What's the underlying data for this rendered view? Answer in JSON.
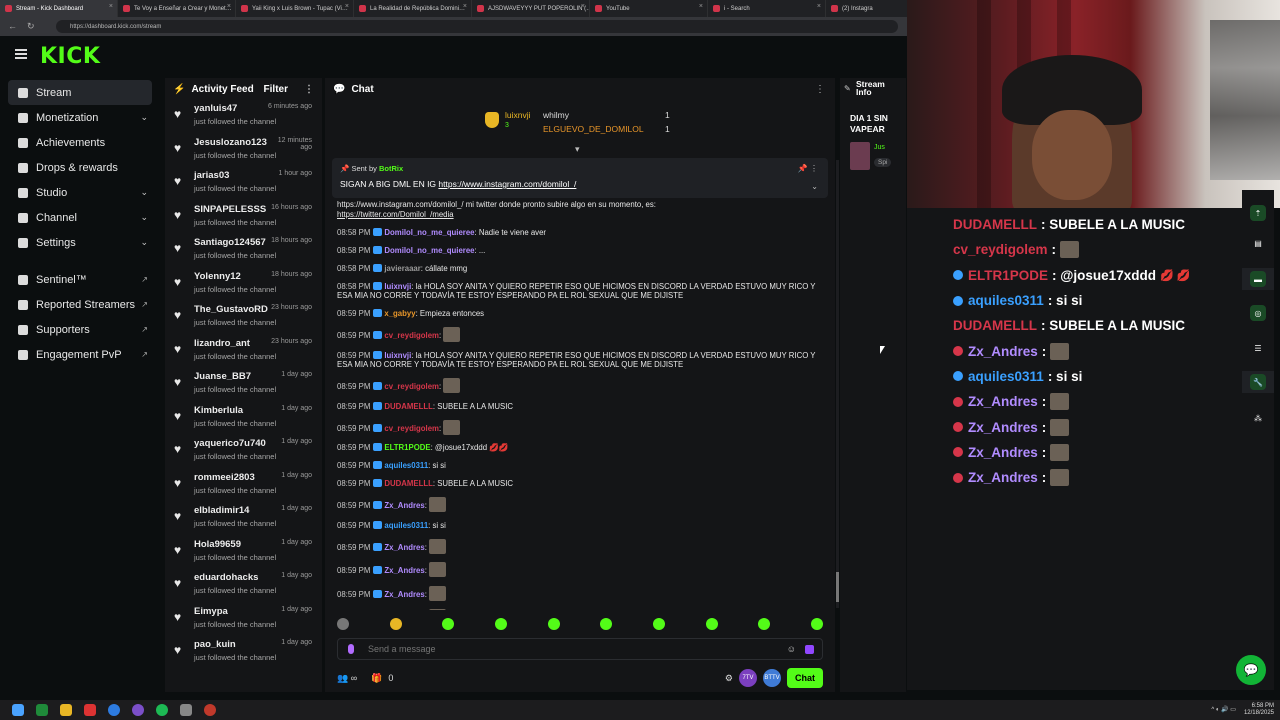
{
  "browser": {
    "tabs": [
      {
        "label": "Stream - Kick Dashboard",
        "active": true
      },
      {
        "label": "Te Voy a Enseñar a Crear y Monet…"
      },
      {
        "label": "Yaii King x Luis Brown - Tupac (Vi…"
      },
      {
        "label": "La Realidad de República Domini…"
      },
      {
        "label": "AJSDWAVEYYY PUT POPEROLIN (…"
      },
      {
        "label": "YouTube"
      },
      {
        "label": "i - Search"
      },
      {
        "label": "(2) Instagra"
      }
    ],
    "url": "https://dashboard.kick.com/stream"
  },
  "brand": {
    "logo": "KICK",
    "accent": "#53fc18"
  },
  "sidebar": {
    "items": [
      {
        "label": "Stream",
        "active": true
      },
      {
        "label": "Monetization",
        "expandable": true
      },
      {
        "label": "Achievements"
      },
      {
        "label": "Drops & rewards"
      },
      {
        "label": "Studio",
        "expandable": true
      },
      {
        "label": "Channel",
        "expandable": true
      },
      {
        "label": "Settings",
        "expandable": true
      }
    ],
    "external": [
      {
        "label": "Sentinel™"
      },
      {
        "label": "Reported Streamers"
      },
      {
        "label": "Supporters"
      },
      {
        "label": "Engagement PvP"
      }
    ]
  },
  "activity_feed": {
    "title": "Activity Feed",
    "filter_label": "Filter",
    "items": [
      {
        "user": "yanluis47",
        "time": "6 minutes ago",
        "text": "just followed the channel"
      },
      {
        "user": "Jesuslozano123",
        "time": "12 minutes ago",
        "text": "just followed the channel"
      },
      {
        "user": "jarias03",
        "time": "1 hour ago",
        "text": "just followed the channel"
      },
      {
        "user": "SINPAPELESSS",
        "time": "16 hours ago",
        "text": "just followed the channel"
      },
      {
        "user": "Santiago124567",
        "time": "18 hours ago",
        "text": "just followed the channel"
      },
      {
        "user": "Yolenny12",
        "time": "18 hours ago",
        "text": "just followed the channel"
      },
      {
        "user": "The_GustavoRD",
        "time": "23 hours ago",
        "text": "just followed the channel"
      },
      {
        "user": "lizandro_ant",
        "time": "23 hours ago",
        "text": "just followed the channel"
      },
      {
        "user": "Juanse_BB7",
        "time": "1 day ago",
        "text": "just followed the channel"
      },
      {
        "user": "Kimberlula",
        "time": "1 day ago",
        "text": "just followed the channel"
      },
      {
        "user": "yaquerico7u740",
        "time": "1 day ago",
        "text": "just followed the channel"
      },
      {
        "user": "rommeei2803",
        "time": "1 day ago",
        "text": "just followed the channel"
      },
      {
        "user": "elbladimir14",
        "time": "1 day ago",
        "text": "just followed the channel"
      },
      {
        "user": "Hola99659",
        "time": "1 day ago",
        "text": "just followed the channel"
      },
      {
        "user": "eduardohacks",
        "time": "1 day ago",
        "text": "just followed the channel"
      },
      {
        "user": "Eimypa",
        "time": "1 day ago",
        "text": "just followed the channel"
      },
      {
        "user": "pao_kuin",
        "time": "1 day ago",
        "text": "just followed the channel"
      }
    ]
  },
  "chat": {
    "title": "Chat",
    "leaderboard": {
      "first": "luixnvji",
      "first_score": "3",
      "second": "whilmy",
      "third": "ELGUEVO_DE_DOMILOL",
      "second_score": "1",
      "third_score": "1"
    },
    "pinned": {
      "sent_by_label": "Sent by",
      "sender": "BotRix",
      "text": "SIGAN A BIG DML EN IG",
      "link": "https://www.instagram.com/domilol_/"
    },
    "messages": [
      {
        "time": "",
        "user": "",
        "color": "#e8e8e8",
        "text": "https://www.instagram.com/domilol_/ mi twitter donde pronto subire algo en su momento, es:",
        "link": "https://twitter.com/Domilol_/media"
      },
      {
        "time": "08:58 PM",
        "user": "Domilol_no_me_quieree",
        "color": "#b18cff",
        "text": ": Nadie te viene aver"
      },
      {
        "time": "08:58 PM",
        "user": "Domilol_no_me_quieree",
        "color": "#b18cff",
        "text": ": ..."
      },
      {
        "time": "08:58 PM",
        "user": "javieraaar",
        "color": "#9a9a9a",
        "text": ": cállate mmg"
      },
      {
        "time": "08:58 PM",
        "user": "luixnvji",
        "color": "#b18cff",
        "text": ": la HOLA SOY ANITA Y QUIERO REPETIR ESO QUE HICIMOS EN DISCORD LA VERDAD ESTUVO MUY RICO Y ESA MIA NO CORRE Y TODAVÍA TE ESTOY ESPERANDO PA EL ROL SEXUAL QUE ME DIJISTE"
      },
      {
        "time": "08:59 PM",
        "user": "x_gabyy",
        "color": "#e8962a",
        "text": ": Empieza entonces"
      },
      {
        "time": "08:59 PM",
        "user": "cv_reydigolem",
        "color": "#d6364a",
        "text": ":",
        "emote": true
      },
      {
        "time": "08:59 PM",
        "user": "luixnvji",
        "color": "#b18cff",
        "text": ": la HOLA SOY ANITA Y QUIERO REPETIR ESO QUE HICIMOS EN DISCORD LA VERDAD ESTUVO MUY RICO Y ESA MIA NO CORRE Y TODAVÍA TE ESTOY ESPERANDO PA EL ROL SEXUAL QUE ME DIJISTE"
      },
      {
        "time": "08:59 PM",
        "user": "cv_reydigolem",
        "color": "#d6364a",
        "text": ":",
        "emote": true
      },
      {
        "time": "08:59 PM",
        "user": "DUDAMELLL",
        "color": "#d6364a",
        "text": ": SUBELE A LA MUSIC"
      },
      {
        "time": "08:59 PM",
        "user": "cv_reydigolem",
        "color": "#d6364a",
        "text": ":",
        "emote": true
      },
      {
        "time": "08:59 PM",
        "user": "ELTR1PODE",
        "color": "#53fc18",
        "text": ": @josue17xddd 💋💋"
      },
      {
        "time": "08:59 PM",
        "user": "aquiles0311",
        "color": "#3aa0ff",
        "text": ": si si"
      },
      {
        "time": "08:59 PM",
        "user": "DUDAMELLL",
        "color": "#d6364a",
        "text": ": SUBELE A LA MUSIC"
      },
      {
        "time": "08:59 PM",
        "user": "Zx_Andres",
        "color": "#b18cff",
        "text": ":",
        "emote": true
      },
      {
        "time": "08:59 PM",
        "user": "aquiles0311",
        "color": "#3aa0ff",
        "text": ": si si"
      },
      {
        "time": "08:59 PM",
        "user": "Zx_Andres",
        "color": "#b18cff",
        "text": ":",
        "emote": true
      },
      {
        "time": "08:59 PM",
        "user": "Zx_Andres",
        "color": "#b18cff",
        "text": ":",
        "emote": true
      },
      {
        "time": "08:59 PM",
        "user": "Zx_Andres",
        "color": "#b18cff",
        "text": ":",
        "emote": true
      },
      {
        "time": "08:59 PM",
        "user": "Zx_Andres",
        "color": "#b18cff",
        "text": ":",
        "emote": true
      }
    ],
    "input_placeholder": "Send a message",
    "footer": {
      "gift_count": "0",
      "send_label": "Chat",
      "badge_7tv": "7TV",
      "badge_ffz": "BTTV"
    }
  },
  "stream_info": {
    "title": "Stream Info",
    "stream_title": "DIA 1 SIN VAPEAR",
    "tag": "Jus",
    "tag2": "Spi"
  },
  "overlay_chat": [
    {
      "user": "DUDAMELLL",
      "color": "#d6364a",
      "text": ": SUBELE A LA MUSIC",
      "badge": ""
    },
    {
      "user": "cv_reydigolem",
      "color": "#d6364a",
      "text": ":",
      "emote": true,
      "badge": ""
    },
    {
      "user": "ELTR1PODE",
      "color": "#d6364a",
      "text": ": @josue17xddd",
      "badge": "#3aa0ff",
      "lips": "💋 💋"
    },
    {
      "user": "aquiles0311",
      "color": "#3aa0ff",
      "text": ": si si",
      "badge": "#3aa0ff"
    },
    {
      "user": "DUDAMELLL",
      "color": "#d6364a",
      "text": ": SUBELE A LA MUSIC",
      "badge": ""
    },
    {
      "user": "Zx_Andres",
      "color": "#b18cff",
      "text": ":",
      "emote": true,
      "badge": "#d6364a"
    },
    {
      "user": "aquiles0311",
      "color": "#3aa0ff",
      "text": ": si si",
      "badge": "#3aa0ff"
    },
    {
      "user": "Zx_Andres",
      "color": "#b18cff",
      "text": ":",
      "emote": true,
      "badge": "#d6364a"
    },
    {
      "user": "Zx_Andres",
      "color": "#b18cff",
      "text": ":",
      "emote": true,
      "badge": "#d6364a"
    },
    {
      "user": "Zx_Andres",
      "color": "#b18cff",
      "text": ":",
      "emote": true,
      "badge": "#d6364a"
    },
    {
      "user": "Zx_Andres",
      "color": "#b18cff",
      "text": ":",
      "emote": true,
      "badge": "#d6364a"
    }
  ],
  "taskbar": {
    "time": "6:58 PM",
    "date": "12/18/2025"
  }
}
